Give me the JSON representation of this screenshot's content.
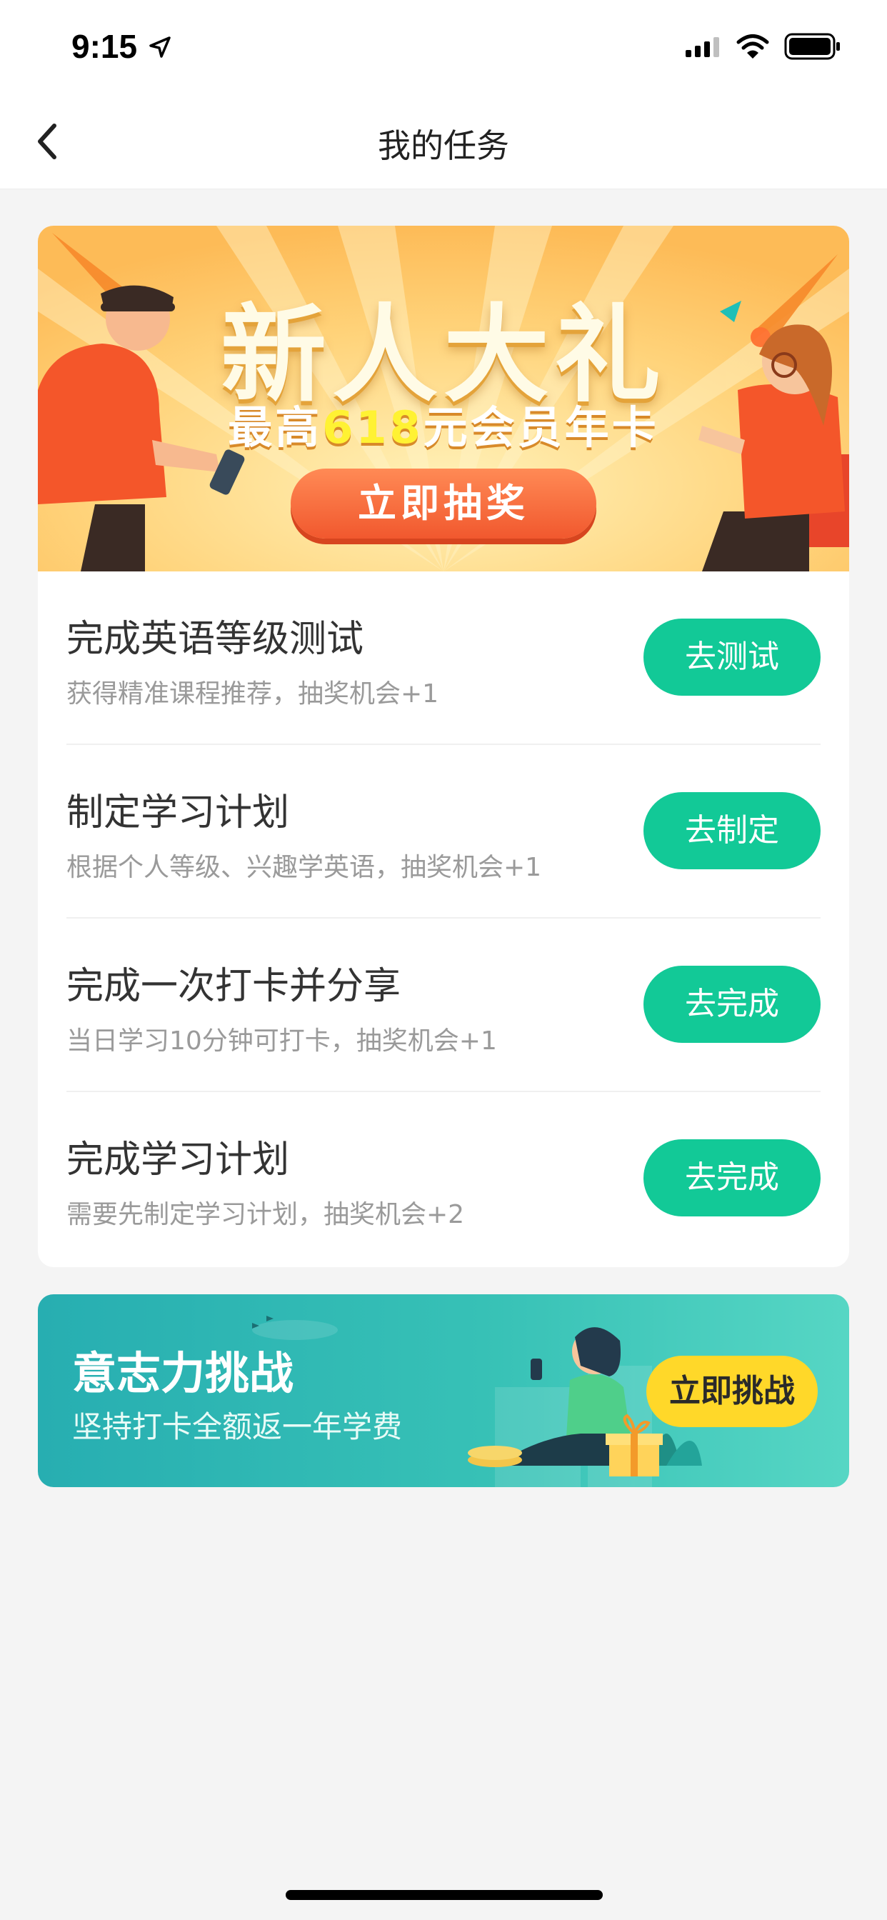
{
  "status_bar": {
    "time": "9:15",
    "icons": [
      "location-arrow-icon",
      "cellular-signal-icon",
      "wifi-icon",
      "battery-icon"
    ]
  },
  "nav": {
    "title": "我的任务",
    "back_icon": "chevron-left-icon"
  },
  "banner": {
    "title": "新人大礼",
    "subtitle_prefix": "最高",
    "subtitle_highlight": "618",
    "subtitle_suffix": "元会员年卡",
    "button_label": "立即抽奖"
  },
  "tasks": [
    {
      "title": "完成英语等级测试",
      "desc": "获得精准课程推荐，抽奖机会+1",
      "button": "去测试"
    },
    {
      "title": "制定学习计划",
      "desc": "根据个人等级、兴趣学英语，抽奖机会+1",
      "button": "去制定"
    },
    {
      "title": "完成一次打卡并分享",
      "desc": "当日学习10分钟可打卡，抽奖机会+1",
      "button": "去完成"
    },
    {
      "title": "完成学习计划",
      "desc": "需要先制定学习计划，抽奖机会+2",
      "button": "去完成"
    }
  ],
  "challenge": {
    "title": "意志力挑战",
    "subtitle": "坚持打卡全额返一年学费",
    "button_label": "立即挑战"
  },
  "colors": {
    "accent": "#12c997",
    "banner_bg": "#fdc25b",
    "challenge_bg": "#2fb5b3",
    "challenge_button": "#ffd829",
    "page_bg": "#f4f4f4"
  }
}
